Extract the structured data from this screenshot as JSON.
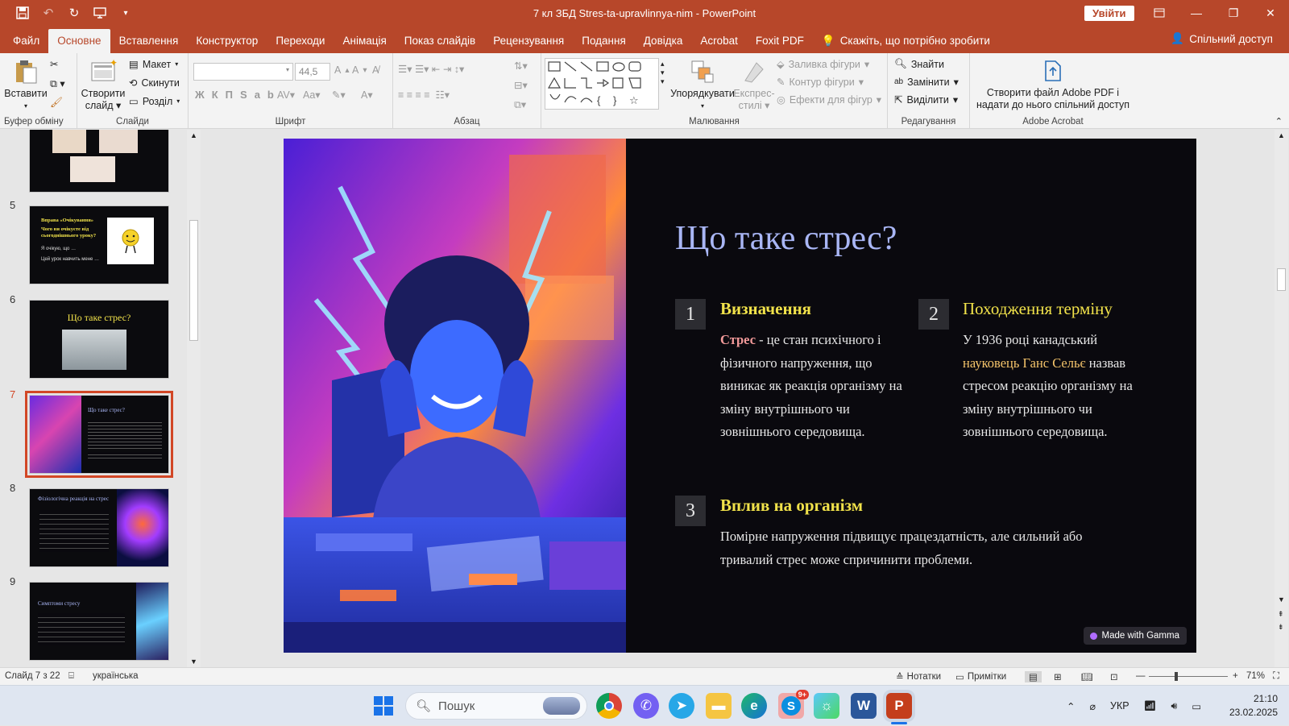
{
  "window": {
    "doc_title": "7 кл ЗБД Stres-ta-upravlinnya-nim  -  PowerPoint",
    "signin_label": "Увійти"
  },
  "tabs": [
    "Файл",
    "Основне",
    "Вставлення",
    "Конструктор",
    "Переходи",
    "Анімація",
    "Показ слайдів",
    "Рецензування",
    "Подання",
    "Довідка",
    "Acrobat",
    "Foxit PDF"
  ],
  "tell_me": "Скажіть, що потрібно зробити",
  "share_label": "Спільний доступ",
  "ribbon": {
    "paste": "Вставити",
    "clipboard_group": "Буфер обміну",
    "new_slide_1": "Створити",
    "new_slide_2": "слайд",
    "layout": "Макет",
    "reset": "Скинути",
    "section": "Розділ",
    "slides_group": "Слайди",
    "font_size": "44,5",
    "font_group": "Шрифт",
    "paragraph_group": "Абзац",
    "arrange": "Упорядкувати",
    "quick_styles_1": "Експрес-",
    "quick_styles_2": "стилі",
    "shape_fill": "Заливка фігури",
    "shape_outline": "Контур фігури",
    "shape_effects": "Ефекти для фігур",
    "drawing_group": "Малювання",
    "find": "Знайти",
    "replace": "Замінити",
    "select": "Виділити",
    "editing_group": "Редагування",
    "acrobat_1": "Створити файл Adobe PDF і",
    "acrobat_2": "надати до нього спільний доступ",
    "acrobat_group": "Adobe Acrobat"
  },
  "thumbnails": {
    "numbers": [
      "5",
      "6",
      "7",
      "8",
      "9"
    ],
    "slide5_title": "Вправа «Очікування»",
    "slide5_q": "Чого ви очікуєте від сьогоднішнього уроку?",
    "slide5_a1": "Я очікую, що …",
    "slide5_a2": "Цей урок навчить мене …",
    "slide6_title": "Що таке стрес?",
    "slide8_title": "Фізіологічна реакція на стрес",
    "slide9_title": "Симптоми стресу"
  },
  "slide": {
    "title": "Що таке стрес?",
    "item1_num": "1",
    "item1_heading": "Визначення",
    "item1_bold": "Стрес",
    "item1_text": " - це стан психічного і фізичного напруження, що виникає як реакція організму на зміну внутрішнього чи зовнішнього середовища.",
    "item2_num": "2",
    "item2_heading": "Походження терміну",
    "item2_text_a": "У 1936 році канадський ",
    "item2_highlight": "науковець Ганс Сельє",
    "item2_text_b": " назвав стресом реакцію організму на зміну внутрішнього чи зовнішнього середовища.",
    "item3_num": "3",
    "item3_heading": "Вплив на організм",
    "item3_text": "Помірне напруження підвищує працездатність, але сильний або тривалий стрес може спричинити проблеми.",
    "badge": "Made with Gamma"
  },
  "status": {
    "slide_counter": "Слайд 7 з 22",
    "language": "українська",
    "notes": "Нотатки",
    "comments": "Примітки",
    "zoom": "71%"
  },
  "taskbar": {
    "search_placeholder": "Пошук",
    "skype_badge": "9+",
    "lang": "УКР",
    "time": "21:10",
    "date": "23.02.2025"
  },
  "colors": {
    "accent": "#b7472a",
    "slide_bg": "#0a090e",
    "title_color": "#a9b6f5",
    "heading_color": "#f1e24a"
  }
}
